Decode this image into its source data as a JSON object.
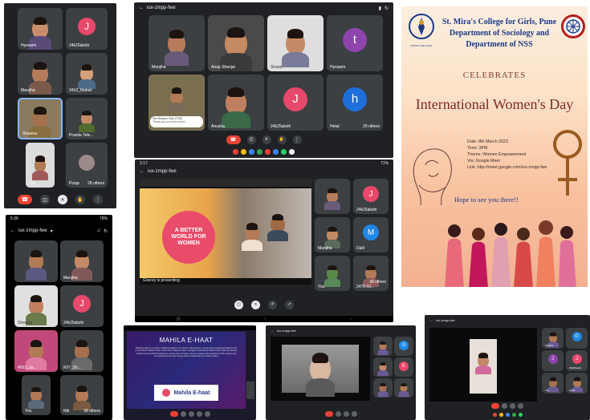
{
  "phone_left": {
    "tiles": [
      {
        "name": "Hyeasim",
        "kind": "video",
        "shirt": "#5a4a7a"
      },
      {
        "name": "24k25akshi",
        "kind": "avatar",
        "letter": "J",
        "color": "#e8486b"
      },
      {
        "name": "Manjiha",
        "kind": "video",
        "shirt": "#7a5a4a"
      },
      {
        "name": "3410_Mahek",
        "kind": "video",
        "shirt": "#4a6a8a"
      },
      {
        "name": "Shwena",
        "kind": "video",
        "shirt": "#8a7040"
      },
      {
        "name": "Pranita Tele...",
        "kind": "video",
        "shirt": "#556b2f"
      },
      {
        "name": "You",
        "kind": "video",
        "shirt": "#a05a5a"
      },
      {
        "name": "Pooja",
        "kind": "video",
        "shirt": "#667"
      }
    ],
    "others": "28 others"
  },
  "phone_mid": {
    "status_time": "5:36",
    "status_right": "79%",
    "meet_code": "iux-zmpp-fwe",
    "tiles": [
      {
        "name": "",
        "kind": "video",
        "shirt": "#5a5a80"
      },
      {
        "name": "Manjiha",
        "kind": "video",
        "shirt": "#805a5a"
      },
      {
        "name": "Shwena",
        "kind": "video",
        "shirt": "#6a7a4a"
      },
      {
        "name": "24k25akshi",
        "kind": "avatar",
        "letter": "J",
        "color": "#e8486b"
      },
      {
        "name": "4003_Ja...",
        "kind": "video",
        "shirt": "#c0497a"
      },
      {
        "name": "K07_Sh...",
        "kind": "video",
        "shirt": "#6a6a6a"
      },
      {
        "name": "You",
        "kind": "video",
        "shirt": "#5a6a7a"
      },
      {
        "name": "Nik",
        "kind": "video",
        "shirt": "#7a5a40"
      }
    ],
    "others": "38 others"
  },
  "tablet_top": {
    "meet_code": "iux-zmpp-fwe",
    "tiles": [
      {
        "name": "Manjiha",
        "kind": "video",
        "shirt": "#6a5a7a"
      },
      {
        "name": "Anup Shanjai",
        "kind": "video",
        "shirt": "#3a3a3a"
      },
      {
        "name": "Shanji",
        "kind": "video",
        "shirt": "#7a7a9a"
      },
      {
        "name": "Hyeasim",
        "kind": "avatar",
        "letter": "t",
        "color": "#8e44ad"
      },
      {
        "name": "You",
        "kind": "video",
        "shirt": "#7a6a5a"
      },
      {
        "name": "Anusha",
        "kind": "video",
        "shirt": "#3a6a4a"
      },
      {
        "name": "24k25akshi",
        "kind": "avatar",
        "letter": "J",
        "color": "#e8486b"
      },
      {
        "name": "Hetal",
        "kind": "avatar",
        "letter": "h",
        "color": "#1e6fd9"
      }
    ],
    "chat_name": "Shri Bhavan Kale (TSE)",
    "chat_text": "Thank you so much ma'm!",
    "others": "29 others"
  },
  "tablet_mid": {
    "status_time": "2:17",
    "status_right": "71%",
    "meet_code": "iux-zmpp-fwe",
    "slide_badge": "A BETTER WORLD FOR WOMEN",
    "presenting": "Gracey is presenting",
    "side_tiles": [
      {
        "name": "",
        "kind": "video",
        "shirt": "#6a5a7a"
      },
      {
        "name": "24k25akshi",
        "kind": "avatar",
        "letter": "J",
        "color": "#e8486b"
      },
      {
        "name": "Manjiha",
        "kind": "video",
        "shirt": "#5a6a5a"
      },
      {
        "name": "Dalit",
        "kind": "avatar",
        "letter": "M",
        "color": "#1e88e5"
      },
      {
        "name": "You",
        "kind": "video",
        "shirt": "#5a8a5a"
      },
      {
        "name": "2470-Gi...",
        "kind": "video",
        "shirt": "#8a5a5a"
      }
    ],
    "others": "38 others"
  },
  "poster": {
    "college": "St. Mira's College for Girls, Pune",
    "dept1": "Department of Sociology and",
    "dept2": "Department of NSS",
    "logo_caption": "KINDLE THE LIGHT",
    "celebrates": "CELEBRATES",
    "title": "International Women's Day",
    "date": "Date: 8th March 2023",
    "time": "Time: 3PM",
    "theme": "Theme: Women Empowerment",
    "via": "Via: Google Meet",
    "link": "Link: http://meet.google.com/iux-zmpp-fwe",
    "tagline": "Hope to see you there!!"
  },
  "mahila": {
    "heading": "MAHILA E-HAAT",
    "body": "Mahila E-Haat is an online marketing platform for women entrepreneurs, Government recognised platform and is launched in Market Place model and a bilateral online managed by Rashtriya Mahila Kosh under the Ministry of Women and Child Development, Government of India. It aims to support the aspirations of the women who are producing from their homes and to provide them an online market.",
    "logo_text": "Mahila E-haat"
  },
  "tablet_br1": {
    "meet_code": "iux-zmpp-fwe",
    "side_tiles": [
      {
        "name": "",
        "kind": "video",
        "shirt": "#6a5a7a"
      },
      {
        "name": "",
        "kind": "avatar",
        "letter": "G",
        "color": "#1e88e5"
      },
      {
        "name": "",
        "kind": "video",
        "shirt": "#5a6a5a"
      },
      {
        "name": "",
        "kind": "avatar",
        "letter": "K",
        "color": "#e8486b"
      },
      {
        "name": "",
        "kind": "video",
        "shirt": "#5a5a5a"
      },
      {
        "name": "",
        "kind": "video",
        "shirt": "#8a5a5a"
      }
    ]
  },
  "tablet_br2": {
    "meet_code": "iux-zmpp-fwe",
    "side_tiles": [
      {
        "name": "Manjiha",
        "kind": "video",
        "shirt": "#6a5a7a"
      },
      {
        "name": "",
        "kind": "avatar",
        "letter": "G",
        "color": "#1e88e5"
      },
      {
        "name": "",
        "kind": "avatar",
        "letter": "J",
        "color": "#8e44ad"
      },
      {
        "name": "24k25akshi",
        "kind": "avatar",
        "letter": "J",
        "color": "#e8486b"
      },
      {
        "name": "You",
        "kind": "video",
        "shirt": "#5a6a5a"
      },
      {
        "name": "Hetal",
        "kind": "video",
        "shirt": "#8a5a5a"
      }
    ]
  },
  "colors": {
    "meet_dark": "#202124",
    "tile": "#3c4043",
    "end_call": "#ea4335",
    "poster_title": "#7b3a3a",
    "poster_blue": "#1a3a8a"
  }
}
